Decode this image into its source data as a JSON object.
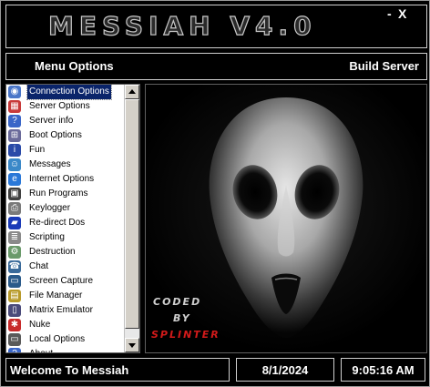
{
  "window": {
    "title": "MESSIAH V4.0",
    "minimize_label": "-",
    "close_label": "X"
  },
  "menubar": {
    "left_label": "Menu Options",
    "right_label": "Build Server"
  },
  "list": {
    "items": [
      {
        "label": "Connection Options",
        "icon": "network-globe-icon",
        "color": "#4a76c8",
        "glyph": "◉",
        "selected": true
      },
      {
        "label": "Server Options",
        "icon": "server-options-icon",
        "color": "#c83a3a",
        "glyph": "▦"
      },
      {
        "label": "Server info",
        "icon": "help-question-icon",
        "color": "#3a66c8",
        "glyph": "?"
      },
      {
        "label": "Boot Options",
        "icon": "network-computers-icon",
        "color": "#6a6a9a",
        "glyph": "⊞"
      },
      {
        "label": "Fun",
        "icon": "info-icon",
        "color": "#2a4aa8",
        "glyph": "i"
      },
      {
        "label": "Messages",
        "icon": "users-icon",
        "color": "#3a88c8",
        "glyph": "☺"
      },
      {
        "label": "Internet Options",
        "icon": "internet-explorer-icon",
        "color": "#2a78d8",
        "glyph": "e"
      },
      {
        "label": "Run Programs",
        "icon": "floppy-disk-icon",
        "color": "#404040",
        "glyph": "▣"
      },
      {
        "label": "Keylogger",
        "icon": "printer-icon",
        "color": "#7a7a7a",
        "glyph": "⎙"
      },
      {
        "label": "Re-direct Dos",
        "icon": "blue-book-icon",
        "color": "#1a3ab8",
        "glyph": "▰"
      },
      {
        "label": "Scripting",
        "icon": "document-script-icon",
        "color": "#8a8a8a",
        "glyph": "≣"
      },
      {
        "label": "Destruction",
        "icon": "control-panel-icon",
        "color": "#6a9a6a",
        "glyph": "⚙"
      },
      {
        "label": "Chat",
        "icon": "chat-phone-icon",
        "color": "#3a6a9a",
        "glyph": "☎"
      },
      {
        "label": "Screen Capture",
        "icon": "monitor-network-icon",
        "color": "#2a5a8a",
        "glyph": "▭"
      },
      {
        "label": "File Manager",
        "icon": "folder-network-icon",
        "color": "#b89a2a",
        "glyph": "▤"
      },
      {
        "label": "Matrix Emulator",
        "icon": "computer-icon",
        "color": "#4a4a7a",
        "glyph": "▯"
      },
      {
        "label": "Nuke",
        "icon": "red-tool-icon",
        "color": "#c82a2a",
        "glyph": "✱"
      },
      {
        "label": "Local Options",
        "icon": "local-computer-icon",
        "color": "#5a5a5a",
        "glyph": "▭"
      },
      {
        "label": "About",
        "icon": "about-icon",
        "color": "#3a66c8",
        "glyph": "?"
      }
    ]
  },
  "image_panel": {
    "credit_line1": "CODED",
    "credit_line2": "BY",
    "credit_line3": "SPLINTER",
    "credit_accent": "#d21a1a"
  },
  "status": {
    "welcome": "Welcome To Messiah",
    "date": "8/1/2024",
    "time": "9:05:16 AM"
  }
}
